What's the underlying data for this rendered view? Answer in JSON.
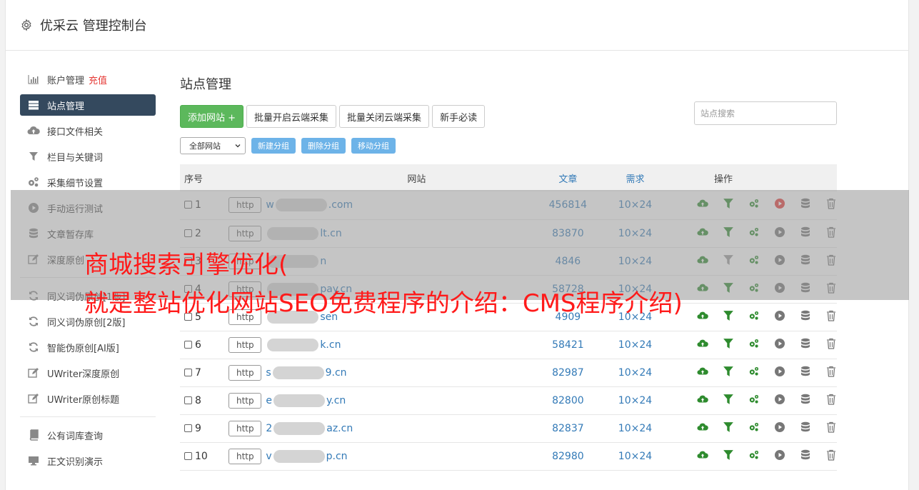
{
  "app": {
    "title": "优采云 管理控制台"
  },
  "sidebar": {
    "items": [
      {
        "label": "账户管理",
        "extra": "充值",
        "icon": "bar-chart-icon"
      },
      {
        "label": "站点管理",
        "icon": "server-icon",
        "active": true
      },
      {
        "label": "接口文件相关",
        "icon": "cloud-upload-icon"
      },
      {
        "label": "栏目与关键词",
        "icon": "filter-icon"
      },
      {
        "label": "采集细节设置",
        "icon": "cogs-icon"
      },
      {
        "label": "手动运行测试",
        "icon": "play-circle-icon"
      },
      {
        "label": "文章暂存库",
        "icon": "database-icon"
      },
      {
        "label": "深度原创",
        "icon": "edit-icon"
      }
    ],
    "items2": [
      {
        "label": "同义词伪原创[1版]",
        "icon": "refresh-icon"
      },
      {
        "label": "同义词伪原创[2版]",
        "icon": "refresh-icon"
      },
      {
        "label": "智能伪原创[AI版]",
        "icon": "refresh-icon"
      },
      {
        "label": "UWriter深度原创",
        "icon": "edit-icon"
      },
      {
        "label": "UWriter原创标题",
        "icon": "edit-icon"
      }
    ],
    "items3": [
      {
        "label": "公有词库查询",
        "icon": "book-icon"
      },
      {
        "label": "正文识别演示",
        "icon": "monitor-icon"
      }
    ]
  },
  "main": {
    "title": "站点管理",
    "buttons": {
      "add": "添加网站 +",
      "batch_open": "批量开启云端采集",
      "batch_close": "批量关闭云端采集",
      "newbie": "新手必读"
    },
    "search_placeholder": "站点搜索",
    "filter": {
      "selected": "全部网站"
    },
    "group_buttons": {
      "new": "新建分组",
      "delete": "删除分组",
      "move": "移动分组"
    },
    "table": {
      "headers": {
        "no": "序号",
        "site": "网站",
        "articles": "文章",
        "demand": "需求",
        "ops": "操作"
      },
      "rows": [
        {
          "no": "1",
          "prefix": "w",
          "suffix": ".com",
          "articles": "456814",
          "demand": "10×24",
          "running": true
        },
        {
          "no": "2",
          "prefix": "",
          "suffix": "lt.cn",
          "articles": "83870",
          "demand": "10×24",
          "running": false
        },
        {
          "no": "3",
          "prefix": "",
          "suffix": "n",
          "articles": "4846",
          "demand": "10×24",
          "running": false,
          "filter_gray": true
        },
        {
          "no": "4",
          "prefix": "",
          "suffix": "pay.cn",
          "articles": "58728",
          "demand": "10×24",
          "running": false
        },
        {
          "no": "5",
          "prefix": "",
          "suffix": "sen",
          "articles": "4909",
          "demand": "10×24",
          "running": false
        },
        {
          "no": "6",
          "prefix": "",
          "suffix": "k.cn",
          "articles": "58421",
          "demand": "10×24",
          "running": false
        },
        {
          "no": "7",
          "prefix": "s",
          "suffix": "9.cn",
          "articles": "82987",
          "demand": "10×24",
          "running": false
        },
        {
          "no": "8",
          "prefix": "e",
          "suffix": "y.cn",
          "articles": "82800",
          "demand": "10×24",
          "running": false
        },
        {
          "no": "9",
          "prefix": "2",
          "suffix": "az.cn",
          "articles": "82837",
          "demand": "10×24",
          "running": false
        },
        {
          "no": "10",
          "prefix": "v",
          "suffix": "p.cn",
          "articles": "82980",
          "demand": "10×24",
          "running": false
        }
      ],
      "http_label": "http"
    }
  },
  "overlay": {
    "line1": "商城搜索引擎优化(",
    "line2": "就是整站优化网站SEO免费程序的介绍：CMS程序介绍)"
  },
  "colors": {
    "accent": "#34495e",
    "green": "#5cb85c",
    "link": "#337ab7",
    "caption": "#ff1a1a",
    "run_red": "#e53935"
  }
}
